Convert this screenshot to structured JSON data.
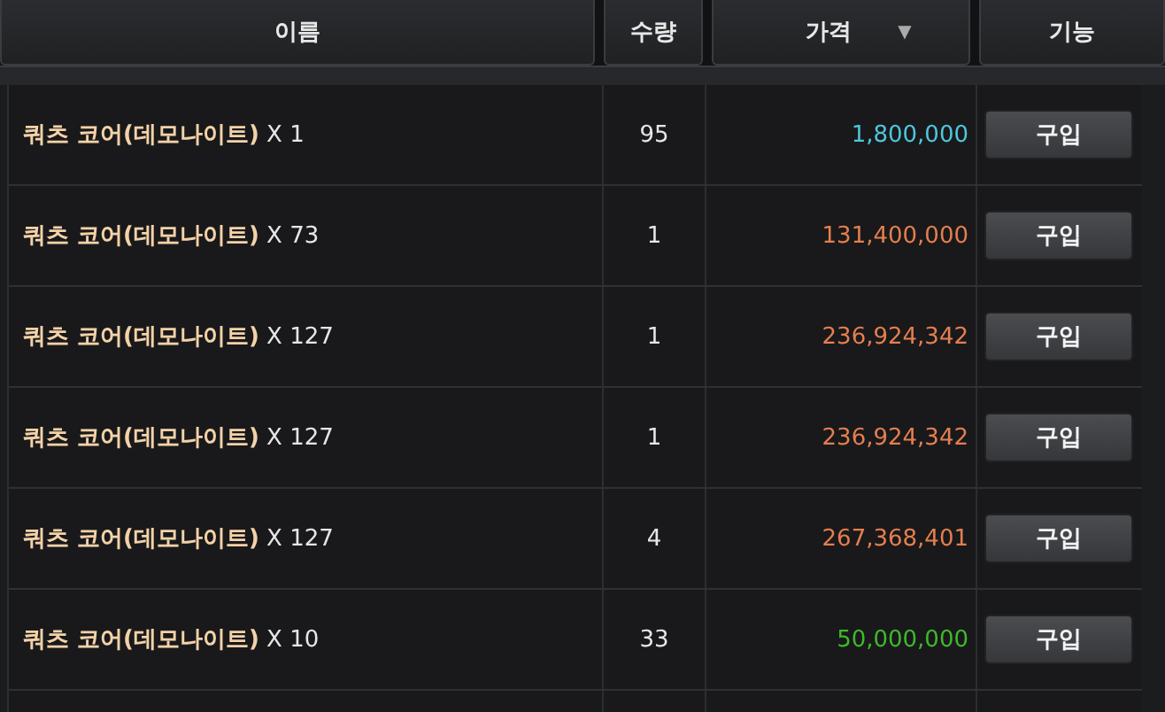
{
  "columns": [
    {
      "label": "이름",
      "sorted": false
    },
    {
      "label": "수량",
      "sorted": false
    },
    {
      "label": "가격",
      "sorted": true,
      "sort_icon": "▼"
    },
    {
      "label": "기능",
      "sorted": false
    }
  ],
  "rows": [
    {
      "name": "**쿼츠 코어(데모나이트)** X 1",
      "quantity": "95",
      "price": "1,800,000",
      "color": "#4fc6dc",
      "action": "구입"
    },
    {
      "name": "**쿼츠 코어(데모나이트)** X 73",
      "quantity": "1",
      "price": "131,400,000",
      "color": "#e47f4e",
      "action": "구입"
    },
    {
      "name": "**쿼츠 코어(데모나이트)** X 127",
      "quantity": "1",
      "price": "236,924,342",
      "color": "#e47f4e",
      "action": "구입"
    },
    {
      "name": "**쿼츠 코어(데모나이트)** X 127",
      "quantity": "1",
      "price": "236,924,342",
      "color": "#e47f4e",
      "action": "구입"
    },
    {
      "name": "**쿼츠 코어(데모나이트)** X 127",
      "quantity": "4",
      "price": "267,368,401",
      "color": "#e47f4e",
      "action": "구입"
    },
    {
      "name": "**쿼츠 코어(데모나이트)** X 10",
      "quantity": "33",
      "price": "50,000,000",
      "color": "#3fb82c",
      "action": "구입"
    }
  ]
}
